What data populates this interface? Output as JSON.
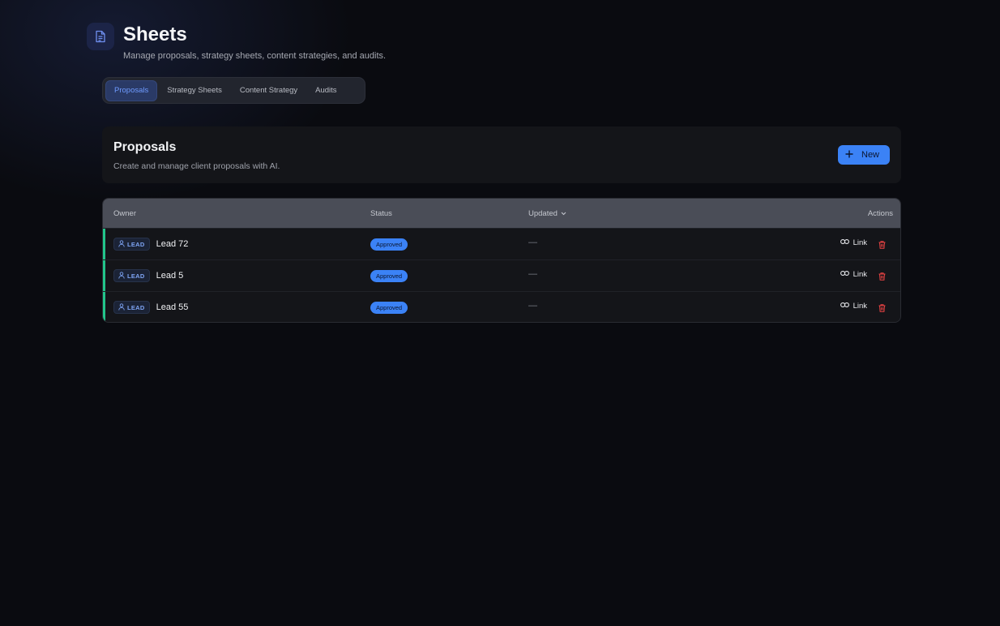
{
  "header": {
    "title": "Sheets",
    "subtitle": "Manage proposals, strategy sheets, content strategies, and audits.",
    "icon": "document-icon"
  },
  "tabs": [
    {
      "label": "Proposals",
      "active": true
    },
    {
      "label": "Strategy Sheets",
      "active": false
    },
    {
      "label": "Content Strategy",
      "active": false
    },
    {
      "label": "Audits",
      "active": false
    }
  ],
  "section": {
    "title": "Proposals",
    "description": "Create and manage client proposals with AI.",
    "new_button": "New"
  },
  "table": {
    "columns": {
      "owner": "Owner",
      "status": "Status",
      "updated": "Updated",
      "actions": "Actions"
    },
    "rows": [
      {
        "badge": "LEAD",
        "name": "Lead 72",
        "status": "Approved",
        "updated": "—",
        "link_label": "Link"
      },
      {
        "badge": "LEAD",
        "name": "Lead 5",
        "status": "Approved",
        "updated": "—",
        "link_label": "Link"
      },
      {
        "badge": "LEAD",
        "name": "Lead 55",
        "status": "Approved",
        "updated": "—",
        "link_label": "Link"
      }
    ]
  },
  "colors": {
    "accent": "#3b82f6",
    "row_indicator": "#22c58b",
    "danger": "#ef4444",
    "background": "#0a0b10"
  }
}
